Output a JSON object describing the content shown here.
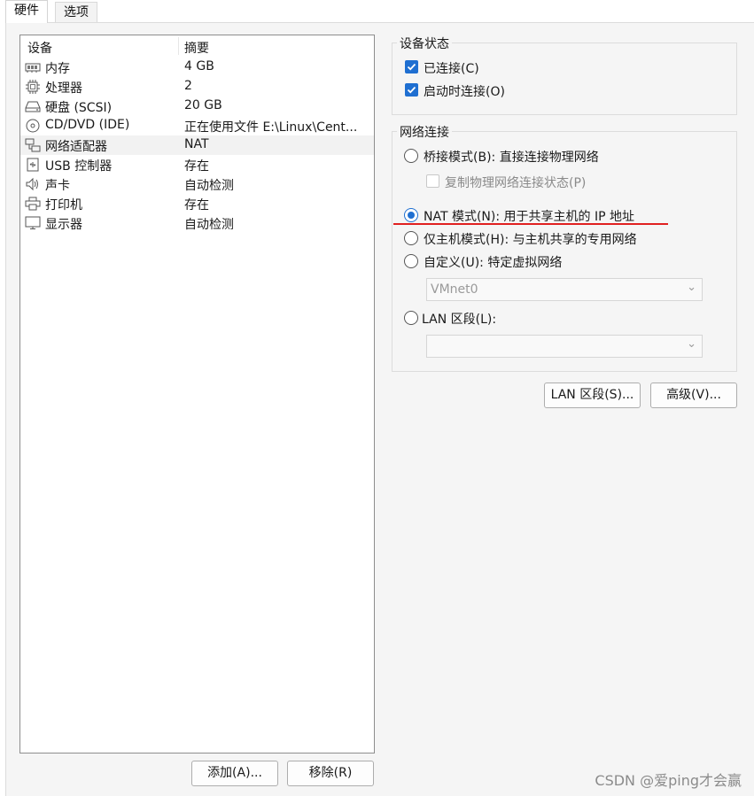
{
  "tabs": {
    "hardware": "硬件",
    "options": "选项"
  },
  "device_list": {
    "header": {
      "device": "设备",
      "summary": "摘要"
    },
    "rows": [
      {
        "icon": "memory-icon",
        "name": "内存",
        "summary": "4 GB"
      },
      {
        "icon": "processor-icon",
        "name": "处理器",
        "summary": "2"
      },
      {
        "icon": "harddisk-icon",
        "name": "硬盘 (SCSI)",
        "summary": "20 GB"
      },
      {
        "icon": "cd-dvd-icon",
        "name": "CD/DVD (IDE)",
        "summary": "正在使用文件 E:\\Linux\\Cent..."
      },
      {
        "icon": "network-adapter-icon",
        "name": "网络适配器",
        "summary": "NAT"
      },
      {
        "icon": "usb-icon",
        "name": "USB 控制器",
        "summary": "存在"
      },
      {
        "icon": "sound-icon",
        "name": "声卡",
        "summary": "自动检测"
      },
      {
        "icon": "printer-icon",
        "name": "打印机",
        "summary": "存在"
      },
      {
        "icon": "display-icon",
        "name": "显示器",
        "summary": "自动检测"
      }
    ],
    "selected_index": 4
  },
  "buttons": {
    "add": "添加(A)...",
    "remove": "移除(R)",
    "lan_segments": "LAN 区段(S)...",
    "advanced": "高级(V)..."
  },
  "device_status": {
    "title": "设备状态",
    "connected": {
      "label": "已连接(C)",
      "checked": true
    },
    "connect_on_start": {
      "label": "启动时连接(O)",
      "checked": true
    }
  },
  "network": {
    "title": "网络连接",
    "bridged": "桥接模式(B): 直接连接物理网络",
    "replicate": "复制物理网络连接状态(P)",
    "nat": "NAT 模式(N): 用于共享主机的 IP 地址",
    "host_only": "仅主机模式(H): 与主机共享的专用网络",
    "custom": "自定义(U): 特定虚拟网络",
    "custom_value": "VMnet0",
    "lan_segment": "LAN 区段(L):",
    "lan_value": "",
    "selected": "nat"
  },
  "colors": {
    "accent": "#1f6fd1",
    "annotation_underline": "#e02020"
  },
  "watermark": "CSDN @爱ping才会赢"
}
